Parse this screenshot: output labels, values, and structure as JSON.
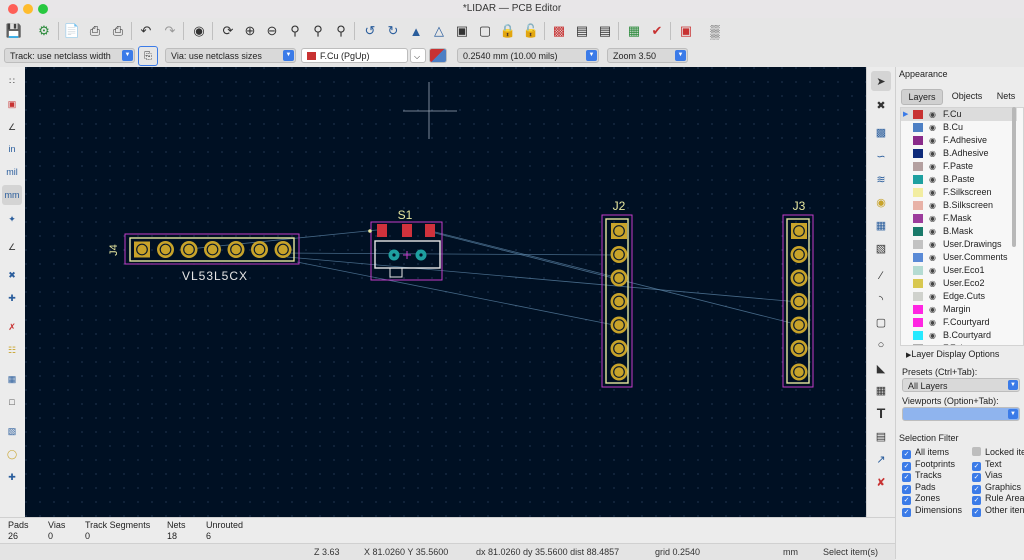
{
  "window": {
    "title": "*LIDAR — PCB Editor"
  },
  "toolbar2": {
    "track_width": "Track: use netclass width",
    "via_size": "Via: use netclass sizes",
    "layer": "F.Cu (PgUp)",
    "grid": "0.2540 mm (10.00 mils)",
    "zoom": "Zoom 3.50"
  },
  "left_tools": {
    "units_in": "in",
    "units_mil": "mil",
    "units_mm": "mm"
  },
  "board": {
    "footprints": [
      {
        "ref": "J4",
        "value": "VL53L5CX"
      },
      {
        "ref": "S1"
      },
      {
        "ref": "J2"
      },
      {
        "ref": "J3"
      }
    ],
    "colors": {
      "background": "#001023",
      "pad": "#c8a32a",
      "silk": "#e8e8a0",
      "courtyard": "#c43cc8",
      "fab": "#e6e6e6",
      "ratsnest": "#5c86a8",
      "smd_pad": "#d0323c"
    }
  },
  "appearance": {
    "title": "Appearance",
    "tabs": [
      "Layers",
      "Objects",
      "Nets"
    ],
    "layers": [
      {
        "name": "F.Cu",
        "color": "#c83232"
      },
      {
        "name": "B.Cu",
        "color": "#4d7fc4"
      },
      {
        "name": "F.Adhesive",
        "color": "#8a2b8a"
      },
      {
        "name": "B.Adhesive",
        "color": "#0e2a7a"
      },
      {
        "name": "F.Paste",
        "color": "#b4a0a0"
      },
      {
        "name": "B.Paste",
        "color": "#1ea0a0"
      },
      {
        "name": "F.Silkscreen",
        "color": "#f2eda1"
      },
      {
        "name": "B.Silkscreen",
        "color": "#e8b2a7"
      },
      {
        "name": "F.Mask",
        "color": "#9c3c9c"
      },
      {
        "name": "B.Mask",
        "color": "#1a7a6a"
      },
      {
        "name": "User.Drawings",
        "color": "#c2c2c2"
      },
      {
        "name": "User.Comments",
        "color": "#5a8ad6"
      },
      {
        "name": "User.Eco1",
        "color": "#b4dbd2"
      },
      {
        "name": "User.Eco2",
        "color": "#d8c850"
      },
      {
        "name": "Edge.Cuts",
        "color": "#d0d2cd"
      },
      {
        "name": "Margin",
        "color": "#ff26e2"
      },
      {
        "name": "F.Courtyard",
        "color": "#ff26e2"
      },
      {
        "name": "B.Courtyard",
        "color": "#26e9ff"
      },
      {
        "name": "F.Fab",
        "color": "#afafaf"
      }
    ],
    "layer_display_options": "Layer Display Options",
    "presets_label": "Presets (Ctrl+Tab):",
    "presets_value": "All Layers",
    "viewports_label": "Viewports (Option+Tab):",
    "viewports_value": ""
  },
  "selection_filter": {
    "title": "Selection Filter",
    "items": [
      {
        "label": "All items",
        "checked": true
      },
      {
        "label": "Locked ite",
        "checked": false
      },
      {
        "label": "Footprints",
        "checked": true
      },
      {
        "label": "Text",
        "checked": true
      },
      {
        "label": "Tracks",
        "checked": true
      },
      {
        "label": "Vias",
        "checked": true
      },
      {
        "label": "Pads",
        "checked": true
      },
      {
        "label": "Graphics",
        "checked": true
      },
      {
        "label": "Zones",
        "checked": true
      },
      {
        "label": "Rule Area",
        "checked": true
      },
      {
        "label": "Dimensions",
        "checked": true
      },
      {
        "label": "Other iten",
        "checked": true
      }
    ]
  },
  "messages": {
    "pads_label": "Pads",
    "pads_value": "26",
    "vias_label": "Vias",
    "vias_value": "0",
    "tracks_label": "Track Segments",
    "tracks_value": "0",
    "nets_label": "Nets",
    "nets_value": "18",
    "unrouted_label": "Unrouted",
    "unrouted_value": "6"
  },
  "status": {
    "zoom": "Z 3.63",
    "xy": "X 81.0260  Y 35.5600",
    "delta": "dx 81.0260  dy 35.5600  dist 88.4857",
    "grid": "grid 0.2540",
    "units": "mm",
    "mode": "Select item(s)"
  }
}
